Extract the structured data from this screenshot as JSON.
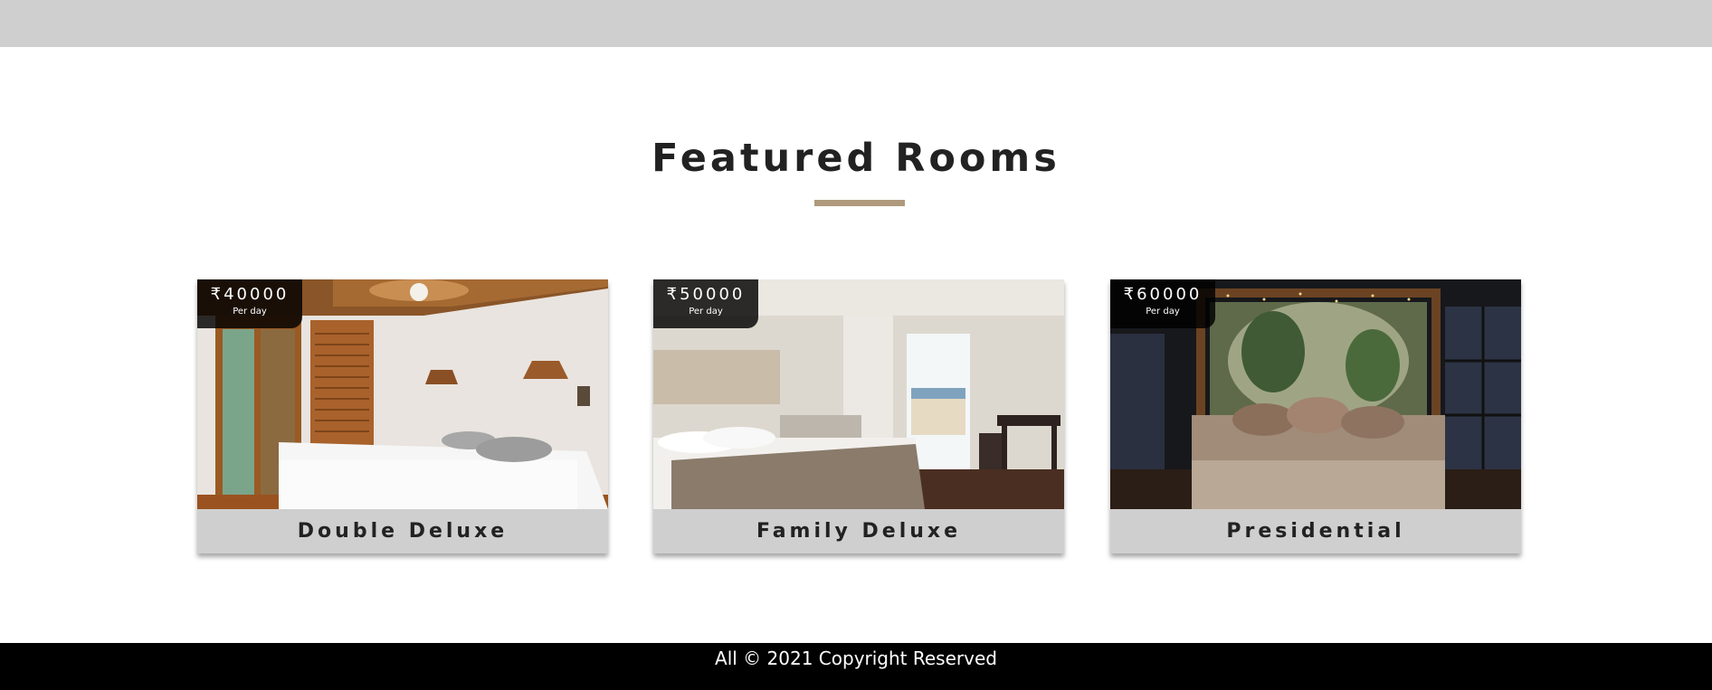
{
  "section": {
    "title": "Featured Rooms",
    "accent_color": "#af9a7d"
  },
  "rooms": [
    {
      "price": "₹40000",
      "price_unit": "Per day",
      "name": "Double Deluxe",
      "image": "bedroom-photo-wooden"
    },
    {
      "price": "₹50000",
      "price_unit": "Per day",
      "name": "Family Deluxe",
      "image": "bedroom-photo-balcony"
    },
    {
      "price": "₹60000",
      "price_unit": "Per day",
      "name": "Presidential",
      "image": "bedroom-photo-canopy"
    }
  ],
  "footer": {
    "text": "All © 2021 Copyright Reserved"
  },
  "colors": {
    "top_bar": "#cfcfcf",
    "card_label_bg": "#cfcfcf",
    "footer_bg": "#000000"
  }
}
